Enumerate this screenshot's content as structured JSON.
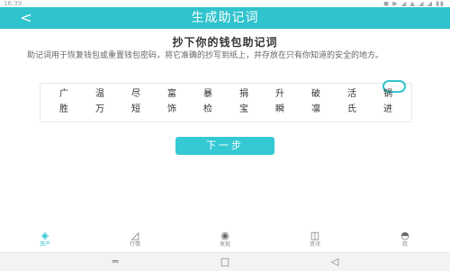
{
  "status_bar": {
    "time": "16:39",
    "indicators": "◼ ▶ ◢ ▲ ◢ ◢ ▮▮"
  },
  "header": {
    "back_icon": "chevron-left-icon",
    "back_glyph": "<",
    "title": "生成助记词",
    "background": "#2fc3cd"
  },
  "main": {
    "heading": "抄下你的钱包助记词",
    "description": "助记词用于恢复钱包或重置钱包密码，将它准确的抄写到纸上，并存放在只有你知道的安全的地方。",
    "words": [
      "广",
      "温",
      "尽",
      "富",
      "暴",
      "捐",
      "升",
      "破",
      "活",
      "锅",
      "胜",
      "万",
      "短",
      "饰",
      "检",
      "宝",
      "瞬",
      "凛",
      "氏",
      "进"
    ],
    "next_button": "下一步",
    "accent": "#35c9d4"
  },
  "tab_bar": {
    "items": [
      {
        "label": "资产",
        "icon": "wallet-icon",
        "glyph": "◈",
        "active": true
      },
      {
        "label": "行情",
        "icon": "chart-icon",
        "glyph": "◿",
        "active": false
      },
      {
        "label": "发现",
        "icon": "discover-icon",
        "glyph": "◉",
        "active": false
      },
      {
        "label": "资讯",
        "icon": "news-icon",
        "glyph": "◫",
        "active": false
      },
      {
        "label": "我",
        "icon": "profile-icon",
        "glyph": "◓",
        "active": false
      }
    ]
  },
  "nav_bar": {
    "menu_glyph": "═",
    "home_glyph": "□",
    "back_glyph": "◁"
  }
}
